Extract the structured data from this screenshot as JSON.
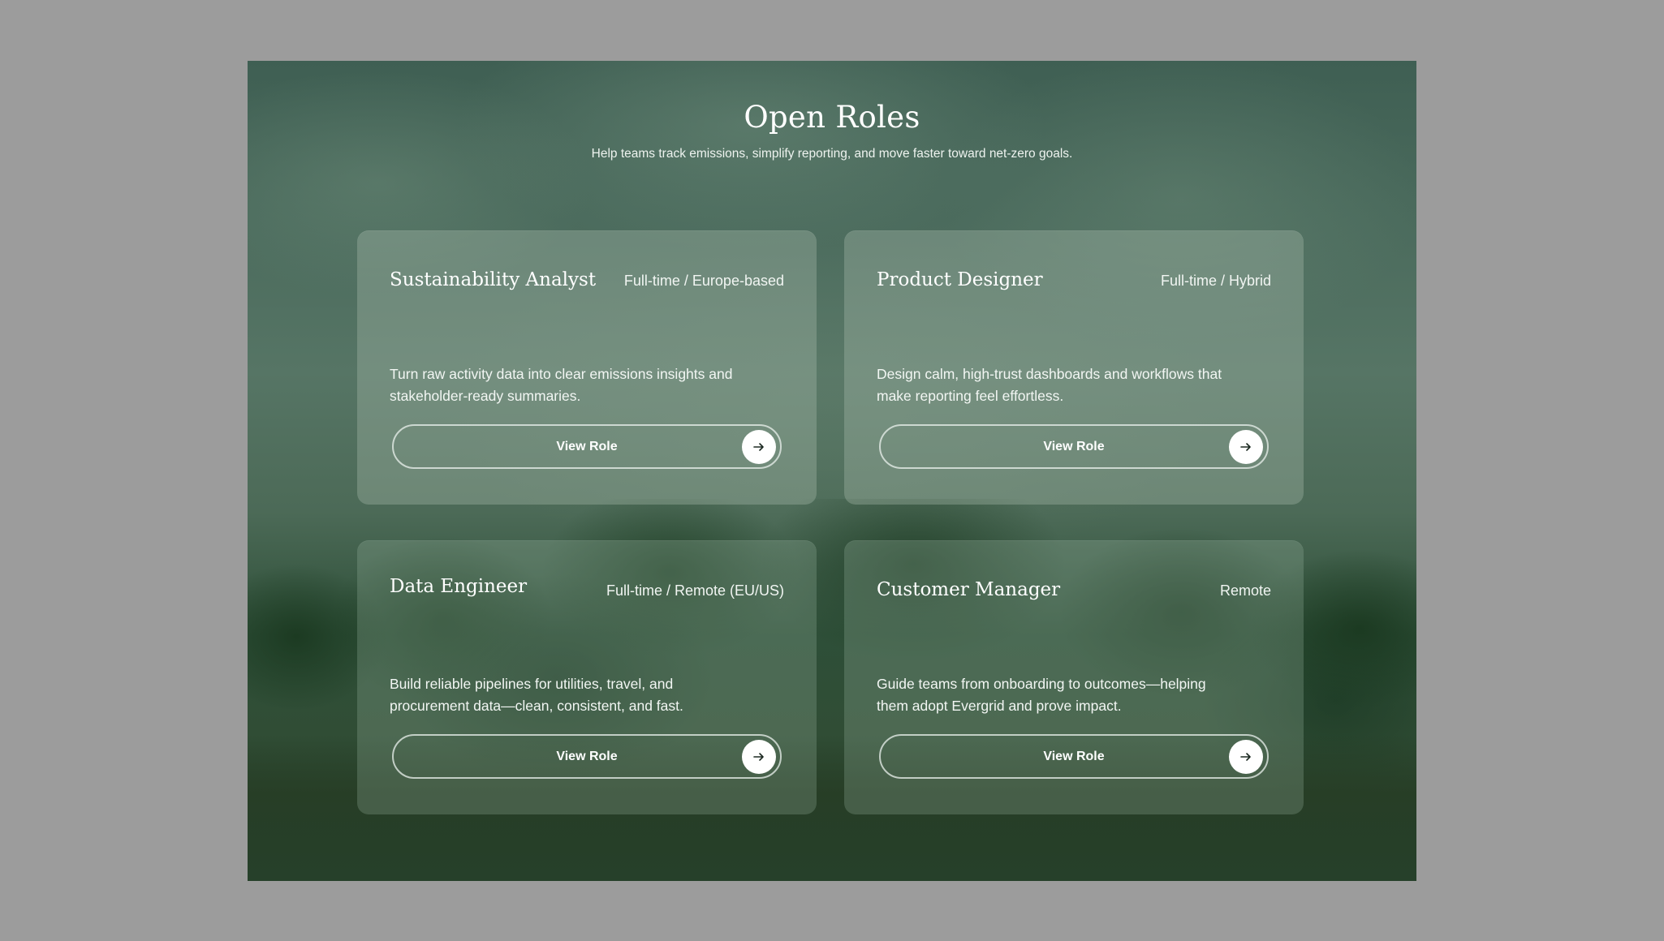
{
  "header": {
    "title": "Open Roles",
    "subtitle": "Help teams track emissions, simplify reporting, and move faster toward net-zero goals."
  },
  "roles": [
    {
      "title": "Sustainability Analyst",
      "meta": "Full-time / Europe-based",
      "description": "Turn raw activity data into clear emissions insights and stakeholder-ready summaries.",
      "button_label": "View Role",
      "button_icon": "arrow-right-icon"
    },
    {
      "title": "Product Designer",
      "meta": "Full-time / Hybrid",
      "description": "Design calm, high-trust dashboards and workflows that make reporting feel effortless.",
      "button_label": "View Role",
      "button_icon": "arrow-right-icon"
    },
    {
      "title": "Data Engineer",
      "meta": "Full-time / Remote (EU/US)",
      "description": "Build reliable pipelines for utilities, travel, and procurement data—clean, consistent, and fast.",
      "button_label": "View Role",
      "button_icon": "arrow-right-icon"
    },
    {
      "title": "Customer Manager",
      "meta": "Remote",
      "description": "Guide teams from onboarding to outcomes—helping them adopt Evergrid and prove impact.",
      "button_label": "View Role",
      "button_icon": "arrow-right-icon"
    }
  ],
  "colors": {
    "page_background": "#9c9c9c",
    "section_green": "#4a6a5c",
    "text": "#ffffff",
    "arrow_circle": "#ffffff"
  }
}
